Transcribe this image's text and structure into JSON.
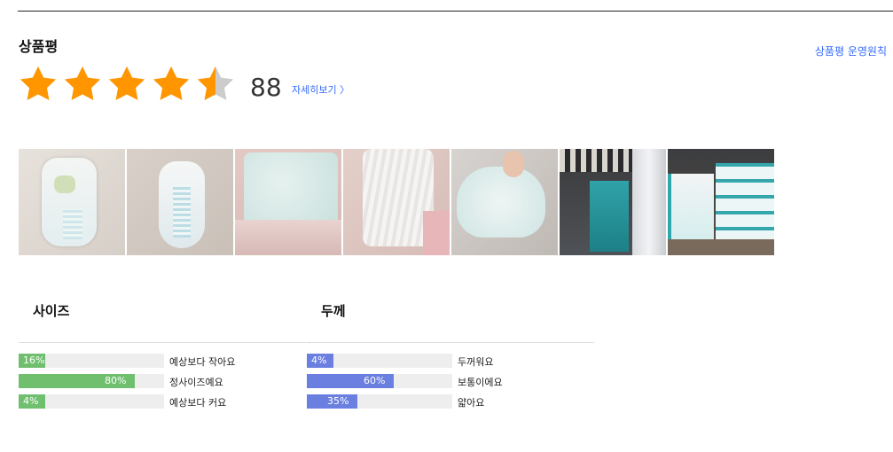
{
  "review": {
    "title": "상품평",
    "policy_link": "상품평 운영원칙",
    "rating_stars": 4.5,
    "review_count": "88",
    "detail_link": "자세히보기 〉",
    "star_color": "#ff9600",
    "star_empty_color": "#cccccc"
  },
  "photos": [
    {
      "name": "review-photo-1"
    },
    {
      "name": "review-photo-2"
    },
    {
      "name": "review-photo-3"
    },
    {
      "name": "review-photo-4"
    },
    {
      "name": "review-photo-5"
    },
    {
      "name": "review-photo-6"
    },
    {
      "name": "review-photo-7"
    }
  ],
  "surveys": [
    {
      "title": "사이즈",
      "color": "#6fbf6f",
      "rows": [
        {
          "percent": "16%",
          "value": 16,
          "label": "예상보다 작아요"
        },
        {
          "percent": "80%",
          "value": 80,
          "label": "정사이즈예요"
        },
        {
          "percent": "4%",
          "value": 4,
          "label": "예상보다 커요"
        }
      ]
    },
    {
      "title": "두께",
      "color": "#6b7fe0",
      "rows": [
        {
          "percent": "4%",
          "value": 4,
          "label": "두꺼워요"
        },
        {
          "percent": "60%",
          "value": 60,
          "label": "보통이에요"
        },
        {
          "percent": "35%",
          "value": 35,
          "label": "얇아요"
        }
      ]
    }
  ]
}
